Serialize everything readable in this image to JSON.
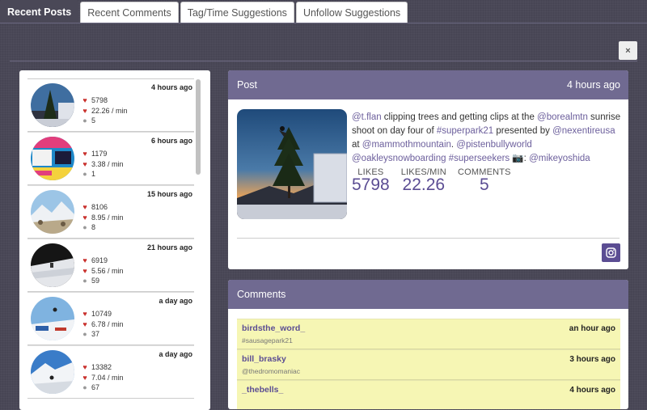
{
  "tabs": [
    {
      "label": "Recent Posts",
      "active": true
    },
    {
      "label": "Recent Comments"
    },
    {
      "label": "Tag/Time Suggestions"
    },
    {
      "label": "Unfollow Suggestions"
    }
  ],
  "close_label": "×",
  "posts": [
    {
      "likes": "5798",
      "rate": "22.26 / min",
      "comments": "5",
      "time": "4 hours ago",
      "thumb": "tree-sunset"
    },
    {
      "likes": "1179",
      "rate": "3.38 / min",
      "comments": "1",
      "time": "6 hours ago",
      "thumb": "event-poster"
    },
    {
      "likes": "8106",
      "rate": "8.95 / min",
      "comments": "8",
      "time": "15 hours ago",
      "thumb": "snowy-mountains"
    },
    {
      "likes": "6919",
      "rate": "5.56 / min",
      "comments": "59",
      "time": "21 hours ago",
      "thumb": "dark-slope"
    },
    {
      "likes": "10749",
      "rate": "6.78 / min",
      "comments": "37",
      "time": "a day ago",
      "thumb": "park-jump"
    },
    {
      "likes": "13382",
      "rate": "7.04 / min",
      "comments": "67",
      "time": "a day ago",
      "thumb": "blue-sky-ridge"
    }
  ],
  "post": {
    "header": "Post",
    "time": "4 hours ago",
    "caption": [
      {
        "t": "@t.flan",
        "link": true
      },
      {
        "t": " clipping trees and getting clips at the ",
        "link": false
      },
      {
        "t": "@borealmtn",
        "link": true
      },
      {
        "t": " sunrise shoot on day four of ",
        "link": false
      },
      {
        "t": "#superpark21",
        "link": true
      },
      {
        "t": " presented by ",
        "link": false
      },
      {
        "t": "@nexentireusa",
        "link": true
      },
      {
        "t": " at ",
        "link": false
      },
      {
        "t": "@mammothmountain",
        "link": true
      },
      {
        "t": ". ",
        "link": false
      },
      {
        "t": "@pistenbullyworld",
        "link": true
      },
      {
        "t": " ",
        "link": false
      },
      {
        "t": "@oakleysnowboarding",
        "link": true
      },
      {
        "t": " ",
        "link": false
      },
      {
        "t": "#superseekers",
        "link": true
      },
      {
        "t": " 📷: ",
        "link": false
      },
      {
        "t": "@mikeyoshida",
        "link": true
      }
    ],
    "metrics": [
      {
        "label": "LIKES",
        "value": "5798"
      },
      {
        "label": "LIKES/MIN",
        "value": "22.26"
      },
      {
        "label": "COMMENTS",
        "value": "5"
      }
    ]
  },
  "comments": {
    "header": "Comments",
    "items": [
      {
        "user": "birdsthe_word_",
        "text": "#sausagepark21",
        "time": "an hour ago"
      },
      {
        "user": "bill_brasky",
        "text": "@thedromomaniac",
        "time": "3 hours ago"
      },
      {
        "user": "_thebells_",
        "text": "",
        "time": "4 hours ago"
      }
    ]
  },
  "colors": {
    "accent": "#706a91",
    "link": "#6c5f9c",
    "heart": "#c9302c",
    "comment_bg": "#f6f6b4"
  }
}
